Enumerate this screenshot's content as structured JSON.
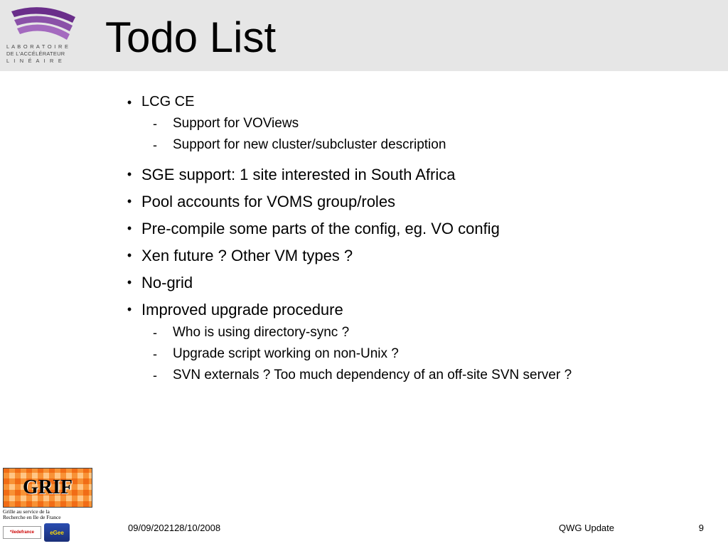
{
  "slide": {
    "title": "Todo List",
    "bullets": [
      {
        "text": "LCG CE",
        "sub": [
          "Support for VOViews",
          "Support for new cluster/subcluster description"
        ]
      },
      {
        "text": "SGE support: 1 site interested in South Africa"
      },
      {
        "text": "Pool accounts for VOMS group/roles"
      },
      {
        "text": "Pre-compile some parts of the config, eg. VO config"
      },
      {
        "text": "Xen future ? Other VM types ?"
      },
      {
        "text": "No-grid"
      },
      {
        "text": "Improved upgrade procedure",
        "sub": [
          "Who is using directory-sync ?",
          "Upgrade script working on non-Unix ?",
          "SVN externals ? Too much dependency of an off-site SVN server ?"
        ]
      }
    ]
  },
  "footer": {
    "date": "09/09/202128/10/2008",
    "center": "QWG Update",
    "page": "9"
  },
  "logos": {
    "lal_line1": "L A B O R A T O I R E",
    "lal_line2": "DE L'ACCÉLÉRATEUR",
    "lal_line3": "L  I  N  É  A  I  R  E",
    "grif_title": "GRIF",
    "grif_sub1": "Grille au service de la",
    "grif_sub2": "Recherche en Ile de France",
    "idf": "*iledefrance",
    "egee": "eGee"
  }
}
